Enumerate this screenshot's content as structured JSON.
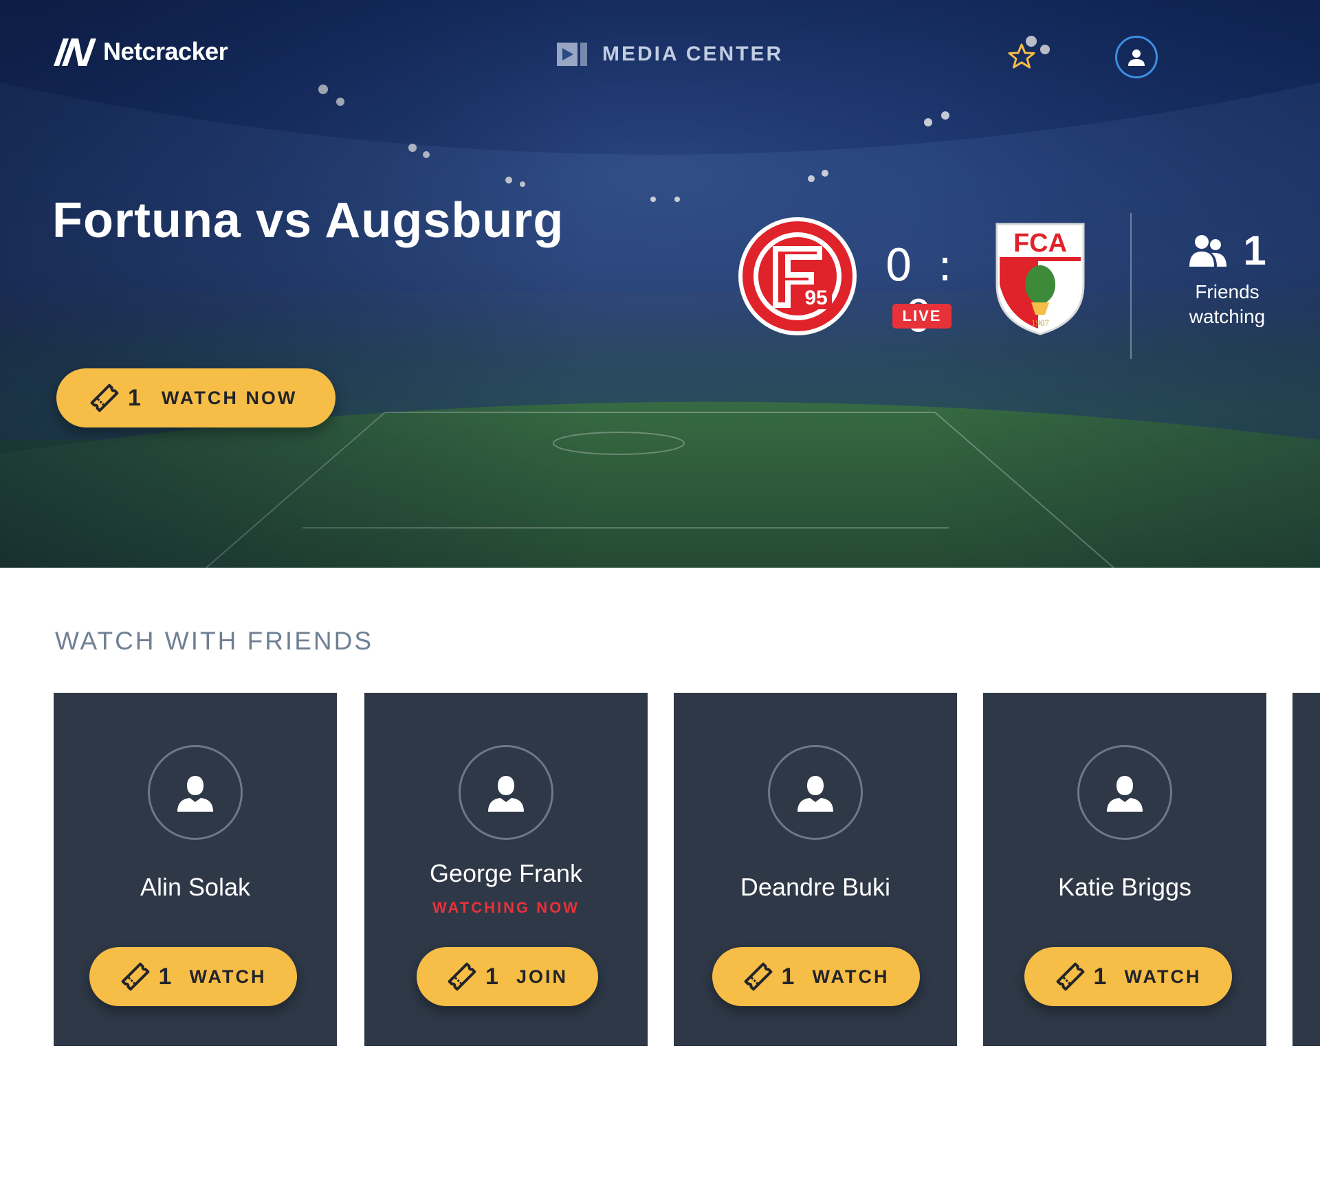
{
  "colors": {
    "accent_yellow": "#f6bd47",
    "live_red": "#e8323a",
    "card_bg": "#2e3847",
    "section_title": "#6f8093",
    "user_ring": "#3e8ee0"
  },
  "header": {
    "logo_text": "Netcracker",
    "logo_icon": "netcracker-logo-icon",
    "nav_label": "MEDIA CENTER",
    "nav_icon": "video-play-icon",
    "favorite_icon": "star-icon",
    "profile_icon": "user-icon"
  },
  "match": {
    "title": "Fortuna vs Augsburg",
    "home_team": {
      "logo_text": "95"
    },
    "away_team": {
      "logo_text": "FCA",
      "logo_year": "1907"
    },
    "score": "0 : 0",
    "status": "LIVE",
    "friends_watching": {
      "count": "1",
      "label_line1": "Friends",
      "label_line2": "watching",
      "icon": "friends-icon"
    },
    "watch_button": {
      "count": "1",
      "label": "WATCH NOW",
      "icon": "ticket-icon"
    }
  },
  "friends_section": {
    "title": "WATCH WITH FRIENDS",
    "friends": [
      {
        "name": "Alin Solak",
        "status": "",
        "button_count": "1",
        "button_label": "WATCH"
      },
      {
        "name": "George Frank",
        "status": "WATCHING NOW",
        "button_count": "1",
        "button_label": "JOIN"
      },
      {
        "name": "Deandre Buki",
        "status": "",
        "button_count": "1",
        "button_label": "WATCH"
      },
      {
        "name": "Katie Briggs",
        "status": "",
        "button_count": "1",
        "button_label": "WATCH"
      }
    ]
  }
}
